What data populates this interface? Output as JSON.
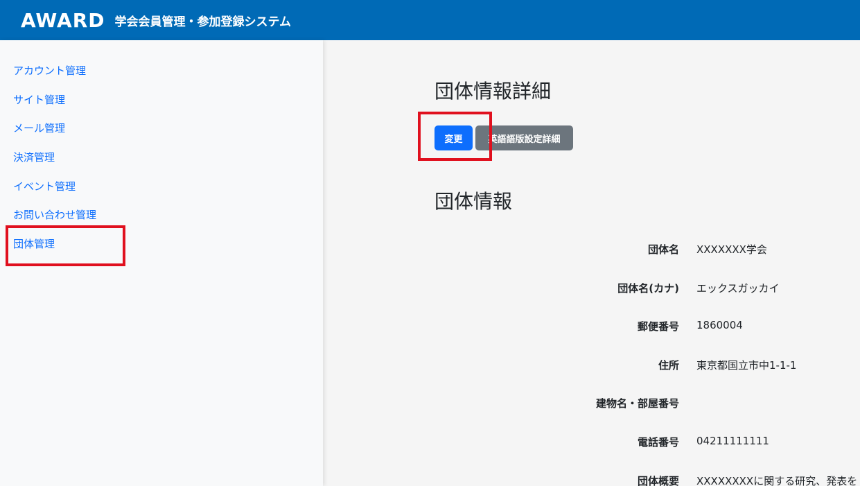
{
  "header": {
    "logo_text": "AWARD",
    "system_title": "学会会員管理・参加登録システム"
  },
  "sidebar": {
    "items": [
      {
        "label": "アカウント管理"
      },
      {
        "label": "サイト管理"
      },
      {
        "label": "メール管理"
      },
      {
        "label": "決済管理"
      },
      {
        "label": "イベント管理"
      },
      {
        "label": "お問い合わせ管理"
      },
      {
        "label": "団体管理"
      }
    ]
  },
  "main": {
    "page_title": "団体情報詳細",
    "buttons": {
      "edit": "変更",
      "english_detail": "英語語版設定詳細"
    },
    "section_title": "団体情報",
    "fields": [
      {
        "label": "団体名",
        "value": "XXXXXXX学会"
      },
      {
        "label": "団体名(カナ)",
        "value": "エックスガッカイ"
      },
      {
        "label": "郵便番号",
        "value": "1860004"
      },
      {
        "label": "住所",
        "value": "東京都国立市中1-1-1"
      },
      {
        "label": "建物名・部屋番号",
        "value": ""
      },
      {
        "label": "電話番号",
        "value": "04211111111"
      },
      {
        "label": "団体概要",
        "value": "XXXXXXXXに関する研究、発表を"
      }
    ]
  },
  "colors": {
    "header_bg": "#006ab6",
    "link": "#0d6efd",
    "primary_button": "#0d6efd",
    "secondary_button": "#6c757d",
    "annotation_box": "#e0101e"
  }
}
